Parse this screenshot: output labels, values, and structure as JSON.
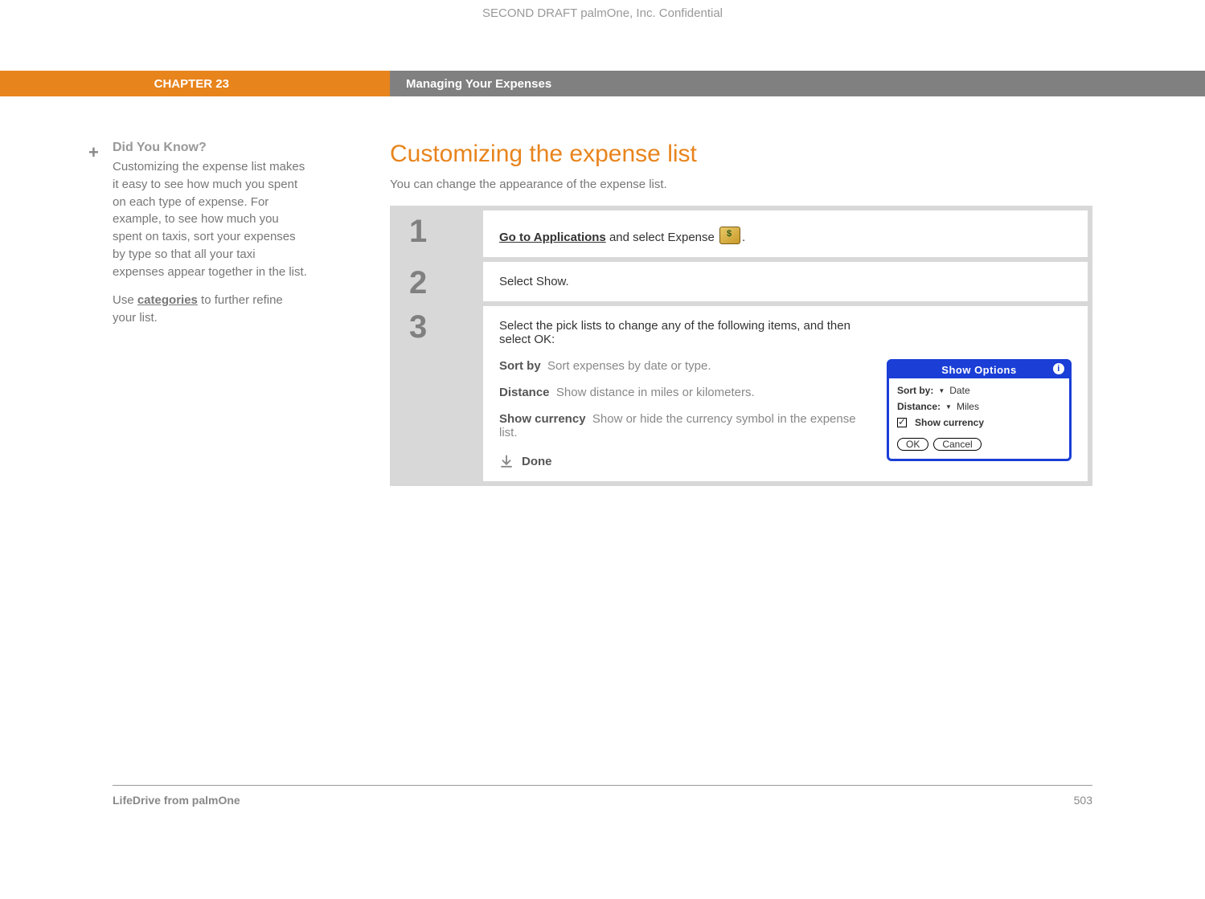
{
  "watermark": "SECOND DRAFT palmOne, Inc.  Confidential",
  "header": {
    "chapter": "CHAPTER 23",
    "title": "Managing Your Expenses"
  },
  "sidebar": {
    "plus": "+",
    "title": "Did You Know?",
    "body1": "Customizing the expense list makes it easy to see how much you spent on each type of expense. For example, to see how much you spent on taxis, sort your expenses by type so that all your taxi expenses appear together in the list.",
    "body2_pre": "Use ",
    "body2_link": "categories",
    "body2_post": " to further refine your list."
  },
  "main": {
    "title": "Customizing the expense list",
    "subtitle": "You can change the appearance of the expense list."
  },
  "steps": [
    {
      "num": "1",
      "link": "Go to Applications",
      "post": " and select Expense ",
      "tail": "."
    },
    {
      "num": "2",
      "text": "Select Show."
    },
    {
      "num": "3",
      "intro": "Select the pick lists to change any of the following items, and then select OK:",
      "options": [
        {
          "label": "Sort by",
          "desc": "Sort expenses by date or type."
        },
        {
          "label": "Distance",
          "desc": "Show distance in miles or kilometers."
        },
        {
          "label": "Show currency",
          "desc": "Show or hide the currency symbol in the expense list."
        }
      ],
      "done": "Done"
    }
  ],
  "dialog": {
    "title": "Show Options",
    "info": "i",
    "sortby_label": "Sort by:",
    "sortby_value": "Date",
    "distance_label": "Distance:",
    "distance_value": "Miles",
    "showcurrency": "Show currency",
    "ok": "OK",
    "cancel": "Cancel"
  },
  "footer": {
    "left": "LifeDrive from palmOne",
    "right": "503"
  }
}
